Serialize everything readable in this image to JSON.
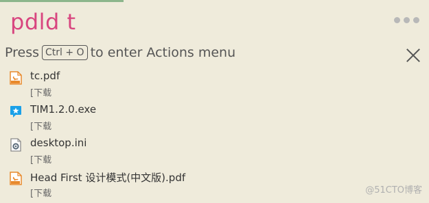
{
  "search": {
    "query": "pdld t"
  },
  "header": {
    "hint_prefix": "Press",
    "hint_key": "Ctrl + O",
    "hint_suffix": "to enter Actions menu"
  },
  "results": [
    {
      "name": "tc.pdf",
      "action": "下载",
      "icon": "pdf-file-icon"
    },
    {
      "name": "TIM1.2.0.exe",
      "action": "下载",
      "icon": "tim-app-icon"
    },
    {
      "name": "desktop.ini",
      "action": "下载",
      "icon": "settings-file-icon"
    },
    {
      "name": "Head First 设计模式(中文版).pdf",
      "action": "下载",
      "icon": "pdf-file-icon"
    }
  ],
  "watermark": "@51CTO博客",
  "colors": {
    "query": "#d8457f",
    "background": "#efebdb",
    "pdf_icon": "#e8892b",
    "tim_icon": "#1aa0e8"
  }
}
